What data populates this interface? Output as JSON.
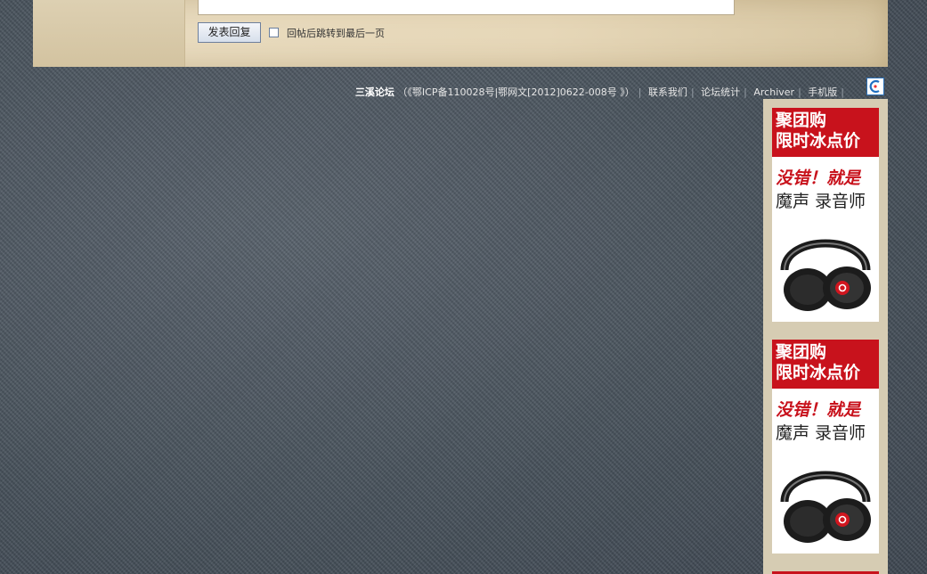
{
  "reply": {
    "submit_label": "发表回复",
    "jump_label": "回帖后跳转到最后一页"
  },
  "footer": {
    "site_name": "三溪论坛",
    "icp": "（《鄂ICP备110028号|鄂网文[2012]0622-008号 》）",
    "contact": "联系我们",
    "stats": "论坛统计",
    "archiver": "Archiver",
    "mobile": "手机版"
  },
  "ads": [
    {
      "banner_line1": "聚团购",
      "banner_line2": "限时冰点价",
      "slogan": "没错！就是",
      "product": "魔声 录音师"
    },
    {
      "banner_line1": "聚团购",
      "banner_line2": "限时冰点价",
      "slogan": "没错！就是",
      "product": "魔声 录音师"
    }
  ],
  "colors": {
    "ad_red": "#c8121c",
    "page_bg": "#4b5560",
    "panel_bg": "#e6d7b8"
  }
}
